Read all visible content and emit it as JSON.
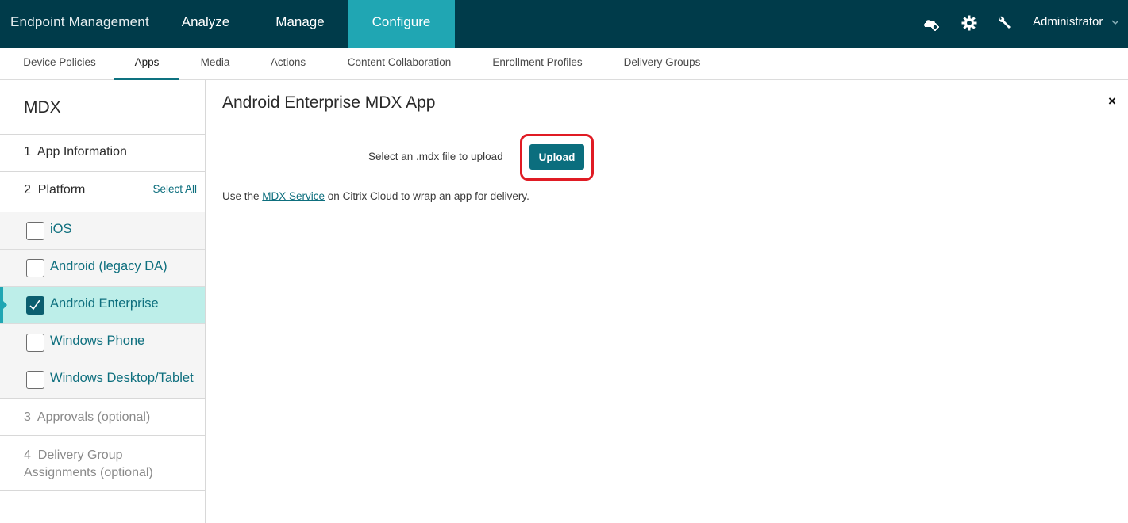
{
  "topbar": {
    "brand": "Endpoint Management",
    "nav": [
      "Analyze",
      "Manage",
      "Configure"
    ],
    "active_nav": "Configure",
    "icons": [
      "cloud-settings-icon",
      "gear-icon",
      "wrench-icon"
    ],
    "user": "Administrator",
    "colors": {
      "bar": "#003b4a",
      "active": "#20a6b3"
    }
  },
  "subnav": {
    "items": [
      "Device Policies",
      "Apps",
      "Media",
      "Actions",
      "Content Collaboration",
      "Enrollment Profiles",
      "Delivery Groups"
    ],
    "active": "Apps"
  },
  "sidebar": {
    "title": "MDX",
    "steps": {
      "s1": {
        "num": "1",
        "label": "App Information"
      },
      "s2": {
        "num": "2",
        "label": "Platform",
        "action": "Select All"
      },
      "s3": {
        "num": "3",
        "label": "Approvals (optional)"
      },
      "s4": {
        "num": "4",
        "label": "Delivery Group",
        "label2": "Assignments (optional)"
      }
    },
    "platforms": [
      {
        "label": "iOS",
        "checked": false
      },
      {
        "label": "Android (legacy DA)",
        "checked": false
      },
      {
        "label": "Android Enterprise",
        "checked": true
      },
      {
        "label": "Windows Phone",
        "checked": false
      },
      {
        "label": "Windows Desktop/Tablet",
        "checked": false
      }
    ]
  },
  "main": {
    "title": "Android Enterprise MDX App",
    "close": "×",
    "upload_label": "Select an .mdx file to upload",
    "upload_button": "Upload",
    "note_prefix": "Use the ",
    "note_link": "MDX Service",
    "note_suffix": " on Citrix Cloud to wrap an app for delivery.",
    "highlight_color": "#e01b24"
  }
}
